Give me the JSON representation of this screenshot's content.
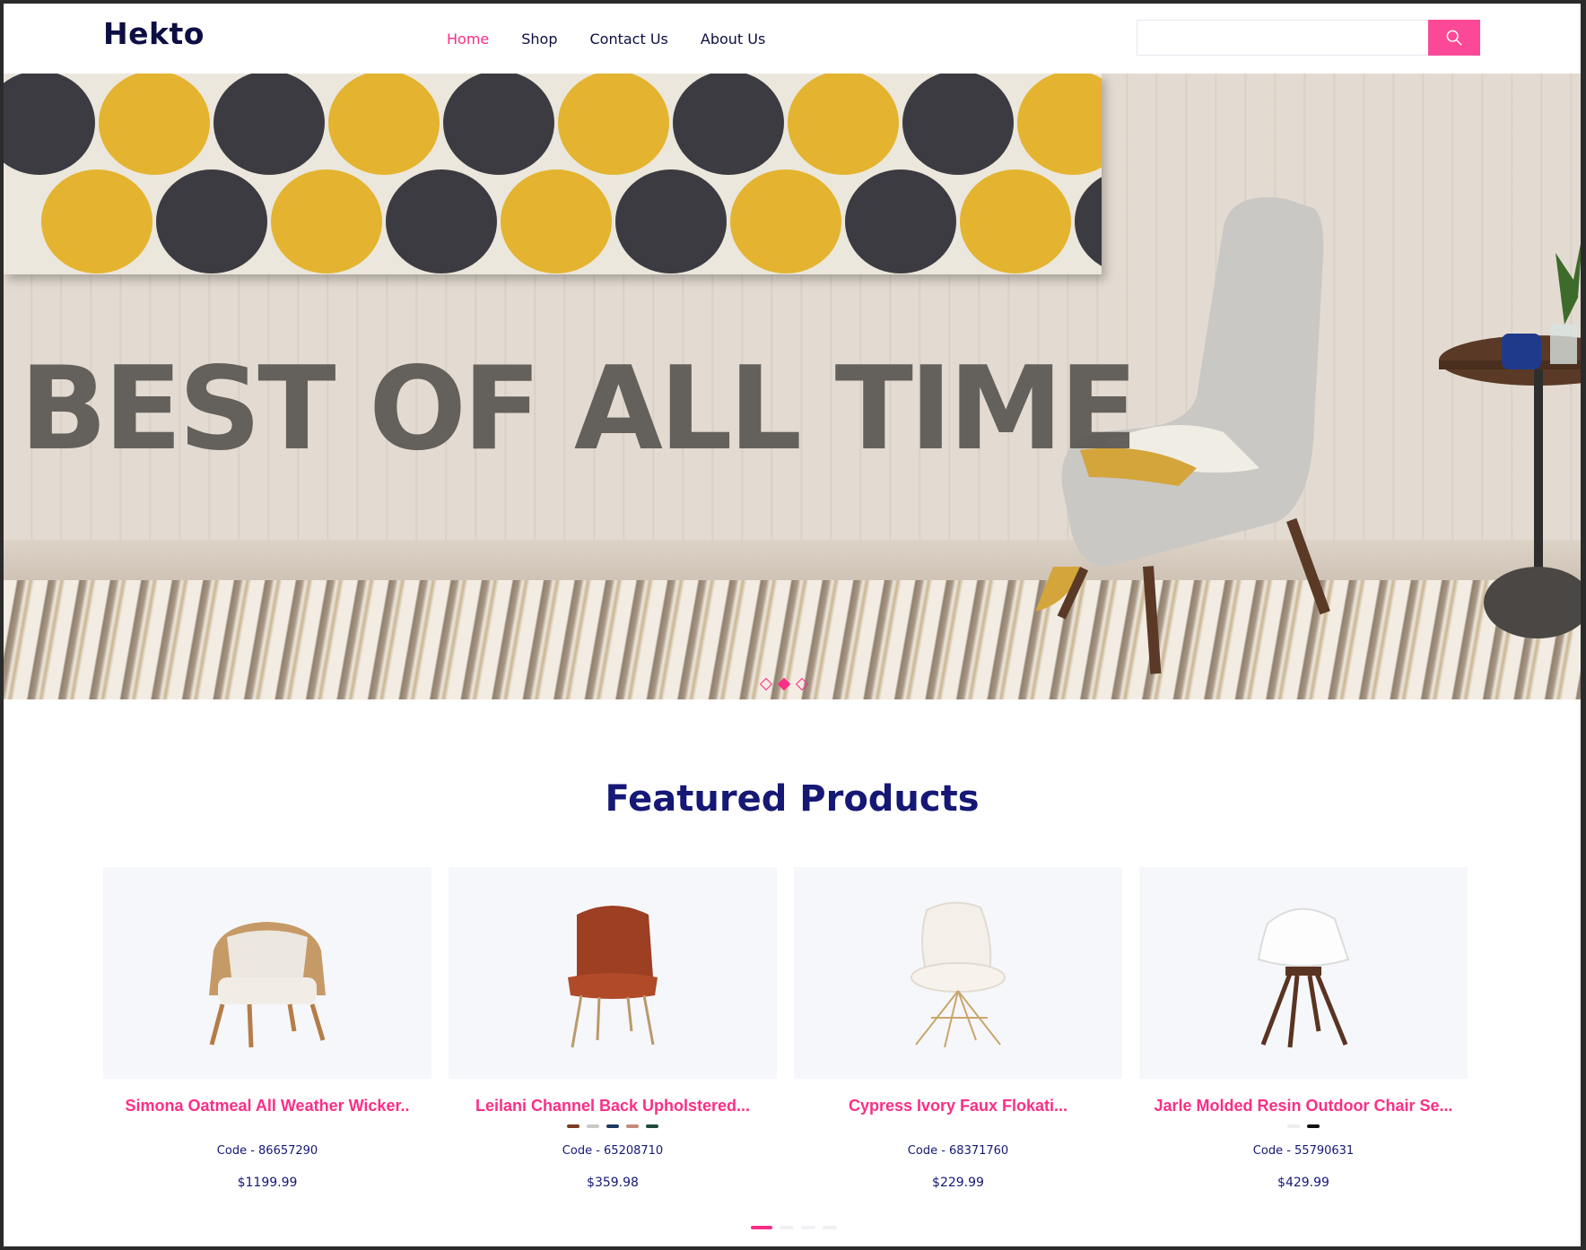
{
  "header": {
    "logo": "Hekto",
    "nav": [
      {
        "label": "Home",
        "active": true
      },
      {
        "label": "Shop",
        "active": false
      },
      {
        "label": "Contact Us",
        "active": false
      },
      {
        "label": "About Us",
        "active": false
      }
    ],
    "search": {
      "value": "",
      "placeholder": ""
    }
  },
  "hero": {
    "title": "BEST OF ALL TIME",
    "slides": 3,
    "active_slide": 2
  },
  "featured": {
    "title": "Featured Products",
    "products": [
      {
        "name": "Simona Oatmeal All Weather Wicker..",
        "code": "Code - 86657290",
        "price": "$1199.99",
        "swatches": []
      },
      {
        "name": "Leilani Channel Back Upholstered...",
        "code": "Code - 65208710",
        "price": "$359.98",
        "swatches": [
          "#7a3b22",
          "#c8c8c8",
          "#1e3a5f",
          "#c48a7a",
          "#1f4a40"
        ]
      },
      {
        "name": "Cypress Ivory Faux Flokati...",
        "code": "Code - 68371760",
        "price": "$229.99",
        "swatches": []
      },
      {
        "name": "Jarle Molded Resin Outdoor Chair Se...",
        "code": "Code - 55790631",
        "price": "$429.99",
        "swatches": [
          "#eeeeee",
          "#111111"
        ]
      }
    ],
    "pages": 4,
    "active_page": 1
  },
  "colors": {
    "accent": "#fb2e86",
    "navy": "#151875",
    "card_bg": "#f6f7fb"
  },
  "icons": {
    "search": "search-icon"
  }
}
